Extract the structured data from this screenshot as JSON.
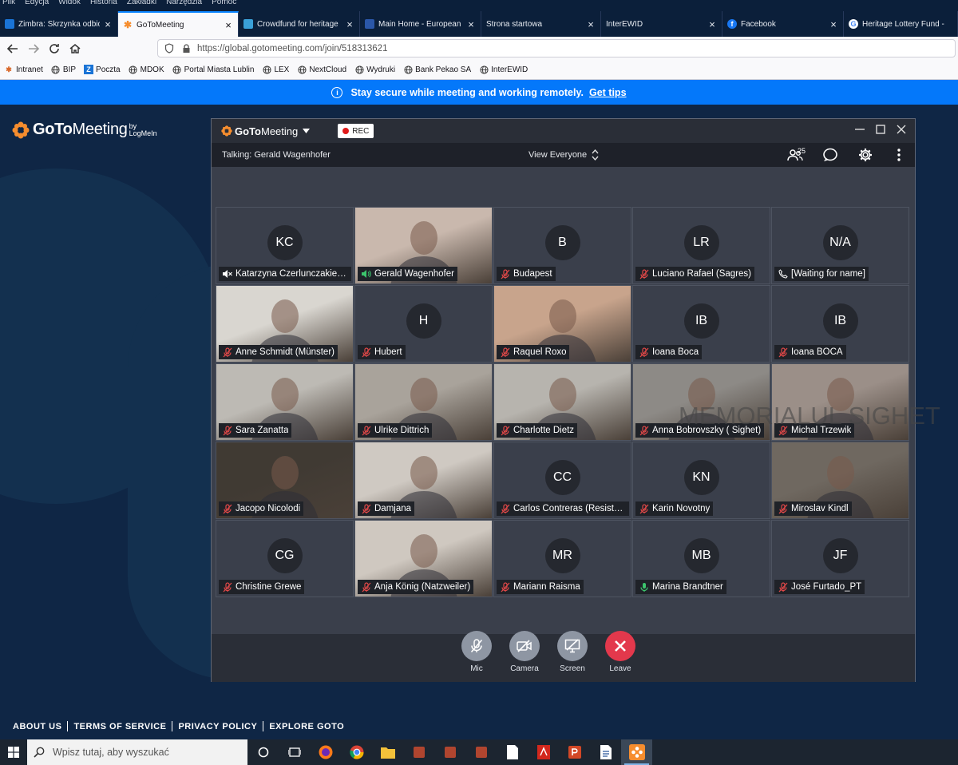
{
  "menubar": [
    "Plik",
    "Edycja",
    "Widok",
    "Historia",
    "Zakładki",
    "Narzędzia",
    "Pomoc"
  ],
  "tabs": [
    {
      "label": "Zimbra: Skrzynka odbiorcza",
      "icon": "zimbra-icon",
      "color": "#1a74d6",
      "active": false,
      "close": "×"
    },
    {
      "label": "GoToMeeting",
      "icon": "gotomeeting-icon",
      "color": "#f68d2e",
      "active": true,
      "close": "×"
    },
    {
      "label": "Crowdfund for heritage",
      "icon": "crowdfund-icon",
      "color": "#3aa0d8",
      "active": false,
      "close": "×"
    },
    {
      "label": "Main Home - European",
      "icon": "europe-icon",
      "color": "#2b57a8",
      "active": false,
      "close": "×"
    },
    {
      "label": "Strona startowa",
      "icon": "",
      "color": "",
      "active": false,
      "close": "×"
    },
    {
      "label": "InterEWID",
      "icon": "",
      "color": "",
      "active": false,
      "close": "×"
    },
    {
      "label": "Facebook",
      "icon": "facebook-icon",
      "color": "#1877f2",
      "active": false,
      "close": "×"
    },
    {
      "label": "Heritage Lottery Fund -",
      "icon": "google-icon",
      "color": "#ffffff",
      "active": false,
      "close": ""
    }
  ],
  "address": {
    "url": "https://global.gotomeeting.com/join/518313621"
  },
  "bookmarks": [
    {
      "label": "Intranet",
      "icon": "intranet-icon"
    },
    {
      "label": "BIP",
      "icon": "globe-icon"
    },
    {
      "label": "Poczta",
      "icon": "mail-icon"
    },
    {
      "label": "MDOK",
      "icon": "globe-icon"
    },
    {
      "label": "Portal Miasta Lublin",
      "icon": "globe-icon"
    },
    {
      "label": "LEX",
      "icon": "globe-icon"
    },
    {
      "label": "NextCloud",
      "icon": "globe-icon"
    },
    {
      "label": "Wydruki",
      "icon": "globe-icon"
    },
    {
      "label": "Bank Pekao SA",
      "icon": "globe-icon"
    },
    {
      "label": "InterEWID",
      "icon": "globe-icon"
    }
  ],
  "banner": {
    "text": "Stay secure while meeting and working remotely.",
    "link": "Get tips"
  },
  "logo": {
    "brand_a": "GoTo",
    "brand_b": "Meeting",
    "by": "by",
    "logmein": "LogMeIn"
  },
  "meeting": {
    "title_a": "GoTo",
    "title_b": "Meeting",
    "rec": "REC",
    "talking": "Talking: Gerald Wagenhofer",
    "view": "View Everyone",
    "participant_count": "25",
    "watermark": "MEMORIALUL SIGHET",
    "tiles": [
      {
        "name": "Katarzyna Czerlunczakiewicz",
        "initials": "KC",
        "status": "speaker-muted",
        "video": false,
        "bg": ""
      },
      {
        "name": "Gerald Wagenhofer",
        "initials": "",
        "status": "speaking",
        "video": true,
        "bg": "#c9b8ad"
      },
      {
        "name": "Budapest",
        "initials": "B",
        "status": "muted",
        "video": false,
        "bg": ""
      },
      {
        "name": "Luciano Rafael (Sagres)",
        "initials": "LR",
        "status": "muted",
        "video": false,
        "bg": ""
      },
      {
        "name": "[Waiting for name]",
        "initials": "N/A",
        "status": "phone",
        "video": false,
        "bg": ""
      },
      {
        "name": "Anne Schmidt (Münster)",
        "initials": "",
        "status": "muted",
        "video": true,
        "bg": "#d9d6d0"
      },
      {
        "name": "Hubert",
        "initials": "H",
        "status": "muted",
        "video": false,
        "bg": ""
      },
      {
        "name": "Raquel Roxo",
        "initials": "",
        "status": "muted",
        "video": true,
        "bg": "#c8a48c"
      },
      {
        "name": "Ioana Boca",
        "initials": "IB",
        "status": "muted",
        "video": false,
        "bg": ""
      },
      {
        "name": "Ioana BOCA",
        "initials": "IB",
        "status": "muted",
        "video": false,
        "bg": ""
      },
      {
        "name": "Sara Zanatta",
        "initials": "",
        "status": "muted",
        "video": true,
        "bg": "#bdbab4"
      },
      {
        "name": "Ulrike Dittrich",
        "initials": "",
        "status": "muted",
        "video": true,
        "bg": "#a9a39b"
      },
      {
        "name": "Charlotte Dietz",
        "initials": "",
        "status": "muted",
        "video": true,
        "bg": "#b7b4ae"
      },
      {
        "name": "Anna Bobrovszky ( Sighet)",
        "initials": "",
        "status": "muted",
        "video": true,
        "bg": "#8d8a86"
      },
      {
        "name": "Michal Trzewik",
        "initials": "",
        "status": "muted",
        "video": true,
        "bg": "#9b8f88"
      },
      {
        "name": "Jacopo Nicolodi",
        "initials": "",
        "status": "muted",
        "video": true,
        "bg": "#403a33"
      },
      {
        "name": "Damjana",
        "initials": "",
        "status": "muted",
        "video": true,
        "bg": "#cfc9c2"
      },
      {
        "name": "Carlos Contreras (Resistencia)",
        "initials": "CC",
        "status": "muted",
        "video": false,
        "bg": ""
      },
      {
        "name": "Karin Novotny",
        "initials": "KN",
        "status": "muted",
        "video": false,
        "bg": ""
      },
      {
        "name": "Miroslav Kindl",
        "initials": "",
        "status": "muted",
        "video": true,
        "bg": "#6f6860"
      },
      {
        "name": "Christine Grewe",
        "initials": "CG",
        "status": "muted",
        "video": false,
        "bg": ""
      },
      {
        "name": "Anja König (Natzweiler)",
        "initials": "",
        "status": "muted",
        "video": true,
        "bg": "#cfc8c0"
      },
      {
        "name": "Mariann Raisma",
        "initials": "MR",
        "status": "muted",
        "video": false,
        "bg": ""
      },
      {
        "name": "Marina Brandtner",
        "initials": "MB",
        "status": "mic-on",
        "video": false,
        "bg": ""
      },
      {
        "name": "José Furtado_PT",
        "initials": "JF",
        "status": "muted",
        "video": false,
        "bg": ""
      }
    ],
    "controls": [
      {
        "label": "Mic",
        "icon": "mic-off-icon"
      },
      {
        "label": "Camera",
        "icon": "camera-off-icon"
      },
      {
        "label": "Screen",
        "icon": "screen-share-icon"
      },
      {
        "label": "Leave",
        "icon": "leave-icon"
      }
    ]
  },
  "footer": [
    "ABOUT US",
    "TERMS OF SERVICE",
    "PRIVACY POLICY",
    "EXPLORE GOTO"
  ],
  "taskbar": {
    "search_placeholder": "Wpisz tutaj, aby wyszukać",
    "apps": [
      "firefox-icon",
      "chrome-icon",
      "file-explorer-icon",
      "app-icon",
      "app-icon",
      "app-icon",
      "document-icon",
      "acrobat-icon",
      "powerpoint-icon",
      "word-icon",
      "gotomeeting-icon"
    ]
  },
  "colors": {
    "accent": "#0478fa",
    "page_bg": "#0f2645",
    "leave": "#e3384c",
    "muted_icon": "#e04848",
    "speaking_icon": "#3cc46c"
  }
}
